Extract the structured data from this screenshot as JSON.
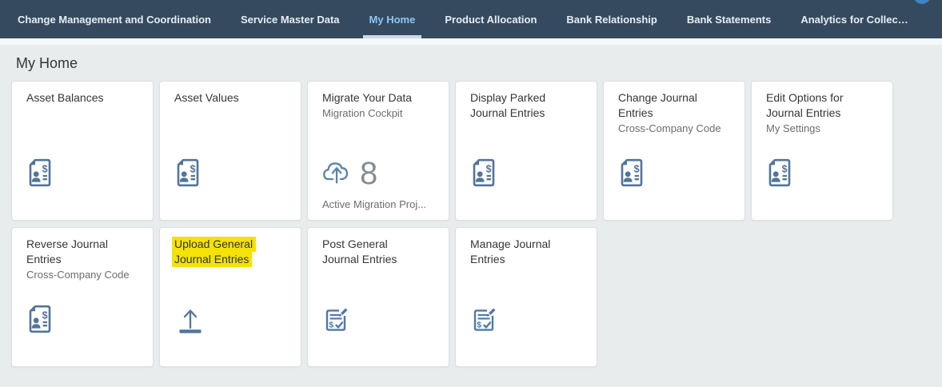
{
  "shellbar": {
    "items": [
      {
        "label": "Change Management and Coordination",
        "selected": false
      },
      {
        "label": "Service Master Data",
        "selected": false
      },
      {
        "label": "My Home",
        "selected": true
      },
      {
        "label": "Product Allocation",
        "selected": false
      },
      {
        "label": "Bank Relationship",
        "selected": false
      },
      {
        "label": "Bank Statements",
        "selected": false
      },
      {
        "label": "Analytics for Collec…",
        "selected": false
      }
    ],
    "icons": {
      "overflow_right": "chevron-right",
      "menu_down": "chevron-down"
    }
  },
  "page": {
    "title": "My Home"
  },
  "tiles": [
    {
      "title": "Asset Balances",
      "subtitle": "",
      "icon": "customer-financial-fact-sheet",
      "footer": ""
    },
    {
      "title": "Asset Values",
      "subtitle": "",
      "icon": "customer-financial-fact-sheet",
      "footer": ""
    },
    {
      "title": "Migrate Your Data",
      "subtitle": "Migration Cockpit",
      "icon": "cloud-upload",
      "kpi": "8",
      "footer": "Active Migration Proj..."
    },
    {
      "title": "Display Parked Journal Entries",
      "subtitle": "",
      "icon": "customer-financial-fact-sheet",
      "footer": ""
    },
    {
      "title": "Change Journal Entries",
      "subtitle": "Cross-Company Code",
      "icon": "customer-financial-fact-sheet",
      "footer": ""
    },
    {
      "title": "Edit Options for Journal Entries",
      "subtitle": "My Settings",
      "icon": "customer-financial-fact-sheet",
      "footer": ""
    },
    {
      "title": "Reverse Journal Entries",
      "subtitle": "Cross-Company Code",
      "icon": "customer-financial-fact-sheet",
      "footer": ""
    },
    {
      "title": "Upload General Journal Entries",
      "subtitle": "",
      "icon": "upload",
      "highlighted": true,
      "footer": ""
    },
    {
      "title": "Post General Journal Entries",
      "subtitle": "",
      "icon": "journal-entries",
      "footer": ""
    },
    {
      "title": "Manage Journal Entries",
      "subtitle": "",
      "icon": "journal-entries",
      "footer": ""
    }
  ],
  "colors": {
    "shellbar_bg": "#354a5f",
    "selected_tab_text": "#8ec7f2",
    "tab_underline": "#c9dbec",
    "content_bg": "#e9eced",
    "tile_bg": "#ffffff",
    "icon_blue": "#52749c",
    "kpi_gray": "#878d92",
    "highlight_yellow": "#f5e206"
  }
}
